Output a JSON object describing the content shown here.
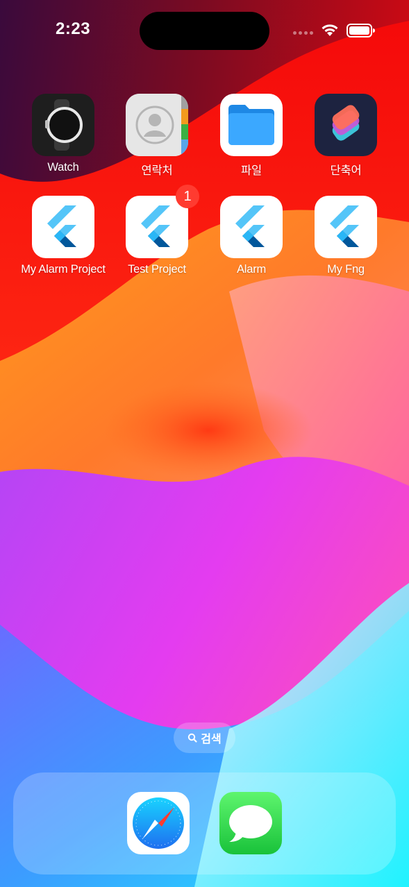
{
  "status_bar": {
    "time": "2:23",
    "icons": [
      "cellular-dots-icon",
      "wifi-icon",
      "battery-icon"
    ]
  },
  "apps": [
    {
      "label": "Watch",
      "icon": "watch-icon",
      "badge": null
    },
    {
      "label": "연락처",
      "icon": "contacts-icon",
      "badge": null
    },
    {
      "label": "파일",
      "icon": "files-folder-icon",
      "badge": null
    },
    {
      "label": "단축어",
      "icon": "shortcuts-icon",
      "badge": null
    },
    {
      "label": "My Alarm Project",
      "icon": "flutter-icon",
      "badge": null
    },
    {
      "label": "Test Project",
      "icon": "flutter-icon",
      "badge": "1"
    },
    {
      "label": "Alarm",
      "icon": "flutter-icon",
      "badge": null
    },
    {
      "label": "My Fng",
      "icon": "flutter-icon",
      "badge": null
    }
  ],
  "search": {
    "label": "검색",
    "icon": "search-icon"
  },
  "dock": [
    {
      "icon": "safari-compass-icon"
    },
    {
      "icon": "messages-bubble-icon"
    }
  ],
  "colors": {
    "badge": "#ff3b30",
    "flutter_light": "#54c5f8",
    "flutter_dark": "#01579b",
    "files_blue": "#1e88e5",
    "messages_green": "#34c759"
  }
}
